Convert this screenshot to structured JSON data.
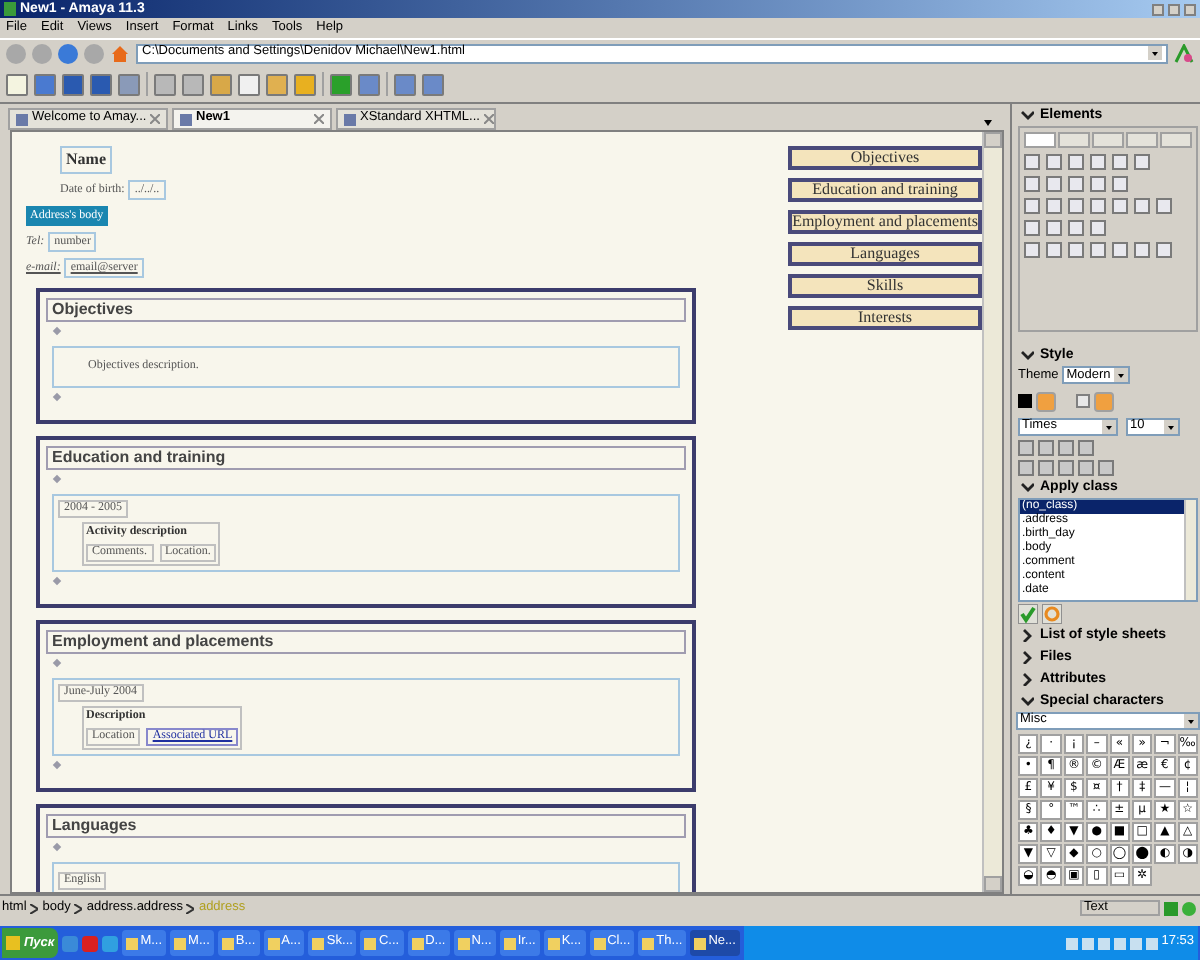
{
  "window": {
    "title": "New1 - Amaya 11.3"
  },
  "menu": [
    "File",
    "Edit",
    "Views",
    "Insert",
    "Format",
    "Links",
    "Tools",
    "Help"
  ],
  "address_bar": {
    "value": "C:\\Documents and Settings\\Denidov Michael\\New1.html"
  },
  "tabs": [
    {
      "label": "Welcome to Amay...",
      "selected": false
    },
    {
      "label": "New1",
      "selected": true
    },
    {
      "label": "XStandard XHTML...",
      "selected": false
    }
  ],
  "document": {
    "name": "Name",
    "birth_label": "Date of birth:",
    "birth_value": "../../..",
    "address": "Address's body",
    "tel_label": "Tel:",
    "tel_value": "number",
    "email_label": "e-mail:",
    "email_value": "email@server",
    "nav": [
      "Objectives",
      "Education and training",
      "Employment and placements",
      "Languages",
      "Skills",
      "Interests"
    ],
    "sections": [
      {
        "title": "Objectives",
        "kind": "description",
        "text": "Objectives description."
      },
      {
        "title": "Education and training",
        "kind": "activity",
        "date": "2004 - 2005",
        "heading": "Activity description",
        "details": [
          {
            "text": "Comments.",
            "kind": "plain"
          },
          {
            "text": "Location.",
            "kind": "plain"
          }
        ]
      },
      {
        "title": "Employment and placements",
        "kind": "activity",
        "date": "June-July 2004",
        "heading": "Description",
        "details": [
          {
            "text": "Location",
            "kind": "plain"
          },
          {
            "text": "Associated URL",
            "kind": "link"
          }
        ]
      },
      {
        "title": "Languages",
        "kind": "language",
        "items": [
          "English"
        ]
      }
    ]
  },
  "panel": {
    "elements_title": "Elements",
    "style_title": "Style",
    "theme_label": "Theme",
    "theme": "Modern",
    "font": "Times",
    "size": "10",
    "apply_class_title": "Apply class",
    "classes": [
      {
        "label": "(no_class)",
        "selected": true
      },
      {
        "label": ".address",
        "selected": false
      },
      {
        "label": ".birth_day",
        "selected": false
      },
      {
        "label": ".body",
        "selected": false
      },
      {
        "label": ".comment",
        "selected": false
      },
      {
        "label": ".content",
        "selected": false
      },
      {
        "label": ".date",
        "selected": false
      }
    ],
    "sections": [
      {
        "label": "List of style sheets",
        "expanded": false
      },
      {
        "label": "Files",
        "expanded": false
      },
      {
        "label": "Attributes",
        "expanded": false
      },
      {
        "label": "Special characters",
        "expanded": true
      }
    ],
    "charset": "Misc",
    "characters": [
      "¿",
      "·",
      "¡",
      "–",
      "«",
      "»",
      "¬",
      "‰",
      "•",
      "¶",
      "®",
      "©",
      "Æ",
      "æ",
      "€",
      "¢",
      "£",
      "¥",
      "$",
      "¤",
      "†",
      "‡",
      "—",
      "¦",
      "§",
      "°",
      "™",
      "∴",
      "±",
      "µ",
      "★",
      "☆",
      "♣",
      "♦",
      "▼",
      "●",
      "■",
      "□",
      "▲",
      "△",
      "▼",
      "▽",
      "◆",
      "○",
      "◯",
      "⬤",
      "◐",
      "◑",
      "◒",
      "◓",
      "▣",
      "▯",
      "▭",
      "✲"
    ]
  },
  "status_bar": {
    "path": [
      "html",
      "body",
      "address.address",
      "address"
    ],
    "mode": "Text"
  },
  "taskbar": {
    "start": "Пуск",
    "items": [
      "M...",
      "M...",
      "B...",
      "A...",
      "Sk...",
      "C...",
      "D...",
      "N...",
      "Ir...",
      "K...",
      "Cl...",
      "Th...",
      "Ne..."
    ],
    "clock": "17:53"
  }
}
